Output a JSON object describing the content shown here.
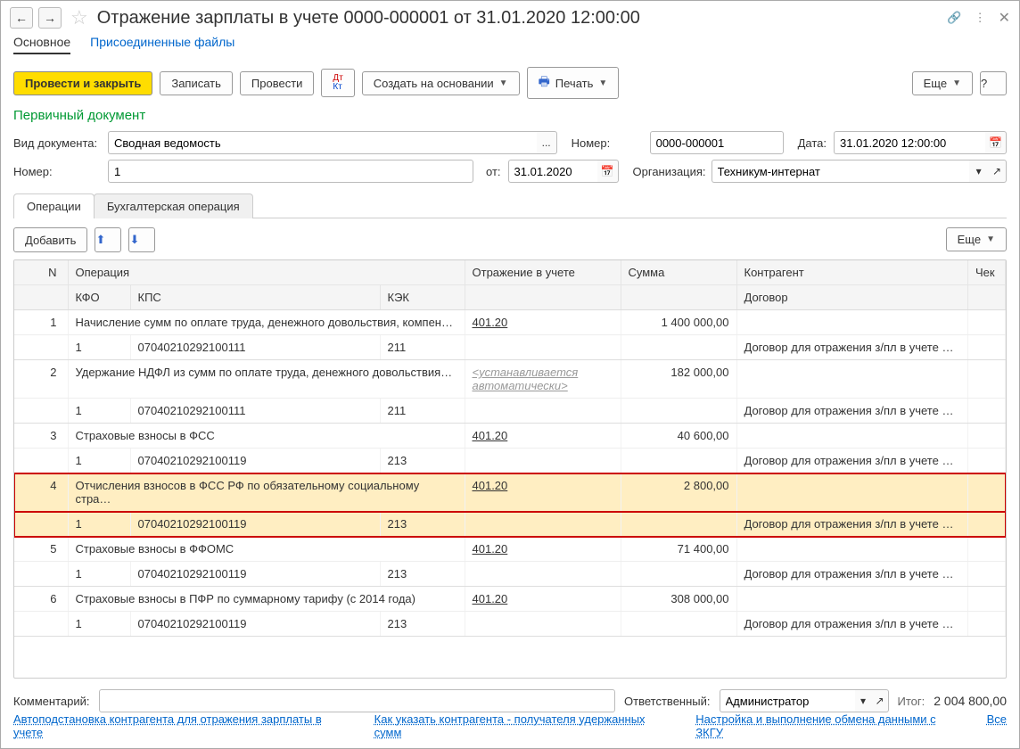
{
  "header": {
    "title": "Отражение зарплаты в учете 0000-000001 от 31.01.2020 12:00:00",
    "back": "←",
    "forward": "→",
    "star": "☆",
    "link_icon": "🔗",
    "more_icon": "⋮",
    "close": "✕"
  },
  "main_tabs": {
    "main": "Основное",
    "attached": "Присоединенные файлы"
  },
  "toolbar": {
    "post_close": "Провести и закрыть",
    "save": "Записать",
    "post": "Провести",
    "debit_credit": "Дт Кт",
    "create_from": "Создать на основании",
    "print": "Печать",
    "printer": "🖶",
    "more": "Еще",
    "help": "?"
  },
  "green": "Первичный документ",
  "form": {
    "doc_type_label": "Вид документа:",
    "doc_type_value": "Сводная ведомость",
    "ellipsis": "...",
    "number_label": "Номер:",
    "number_value": "0000-000001",
    "date_label": "Дата:",
    "date_value": "31.01.2020 12:00:00",
    "calendar": "📅",
    "number2_label": "Номер:",
    "number2_value": "1",
    "from_label": "от:",
    "from_value": "31.01.2020",
    "org_label": "Организация:",
    "org_value": "Техникум-интернат",
    "caret": "▾",
    "open": "↗"
  },
  "inner_tabs": {
    "ops": "Операции",
    "acct": "Бухгалтерская операция"
  },
  "table_toolbar": {
    "add": "Добавить",
    "up": "⬆",
    "down": "⬇",
    "more": "Еще"
  },
  "table": {
    "headers": {
      "n": "N",
      "op": "Операция",
      "reflect": "Отражение в учете",
      "sum": "Сумма",
      "contr": "Контрагент",
      "check": "Чек",
      "kfo": "КФО",
      "kps": "КПС",
      "kek": "КЭК",
      "contract": "Договор"
    },
    "rows": [
      {
        "n": "1",
        "op": "Начисление сумм по оплате труда, денежного довольствия, компен…",
        "reflect": "401.20",
        "sum": "1 400 000,00",
        "contr": "",
        "kfo": "1",
        "kps": "07040210292100111",
        "kek": "211",
        "contract": "Договор для отражения з/пл в учете …"
      },
      {
        "n": "2",
        "op": "Удержание НДФЛ из сумм по оплате труда, денежного довольствия…",
        "reflect": "<устанавливается автоматически>",
        "reflect_muted": true,
        "sum": "182 000,00",
        "contr": "",
        "kfo": "1",
        "kps": "07040210292100111",
        "kek": "211",
        "contract": "Договор для отражения з/пл в учете …"
      },
      {
        "n": "3",
        "op": "Страховые взносы в ФСС",
        "reflect": "401.20",
        "sum": "40 600,00",
        "contr": "",
        "kfo": "1",
        "kps": "07040210292100119",
        "kek": "213",
        "contract": "Договор для отражения з/пл в учете …"
      },
      {
        "n": "4",
        "op": "Отчисления взносов в ФСС РФ по обязательному социальному стра…",
        "reflect": "401.20",
        "sum": "2 800,00",
        "contr": "",
        "kfo": "1",
        "kps": "07040210292100119",
        "kek": "213",
        "contract": "Договор для отражения з/пл в учете …",
        "selected": true
      },
      {
        "n": "5",
        "op": "Страховые взносы в ФФОМС",
        "reflect": "401.20",
        "sum": "71 400,00",
        "contr": "",
        "kfo": "1",
        "kps": "07040210292100119",
        "kek": "213",
        "contract": "Договор для отражения з/пл в учете …"
      },
      {
        "n": "6",
        "op": "Страховые взносы в ПФР по суммарному тарифу (с 2014 года)",
        "reflect": "401.20",
        "sum": "308 000,00",
        "contr": "",
        "kfo": "1",
        "kps": "07040210292100119",
        "kek": "213",
        "contract": "Договор для отражения з/пл в учете …"
      }
    ]
  },
  "footer": {
    "comment_label": "Комментарий:",
    "comment_value": "",
    "resp_label": "Ответственный:",
    "resp_value": "Администратор",
    "itog_label": "Итог:",
    "itog_value": "2 004 800,00"
  },
  "links": {
    "autosubst": "Автоподстановка контрагента для отражения зарплаты в учете",
    "howto": "Как указать контрагента - получателя удержанных сумм",
    "exchange": "Настройка и выполнение обмена данными с ЗКГУ",
    "all": "Все"
  }
}
